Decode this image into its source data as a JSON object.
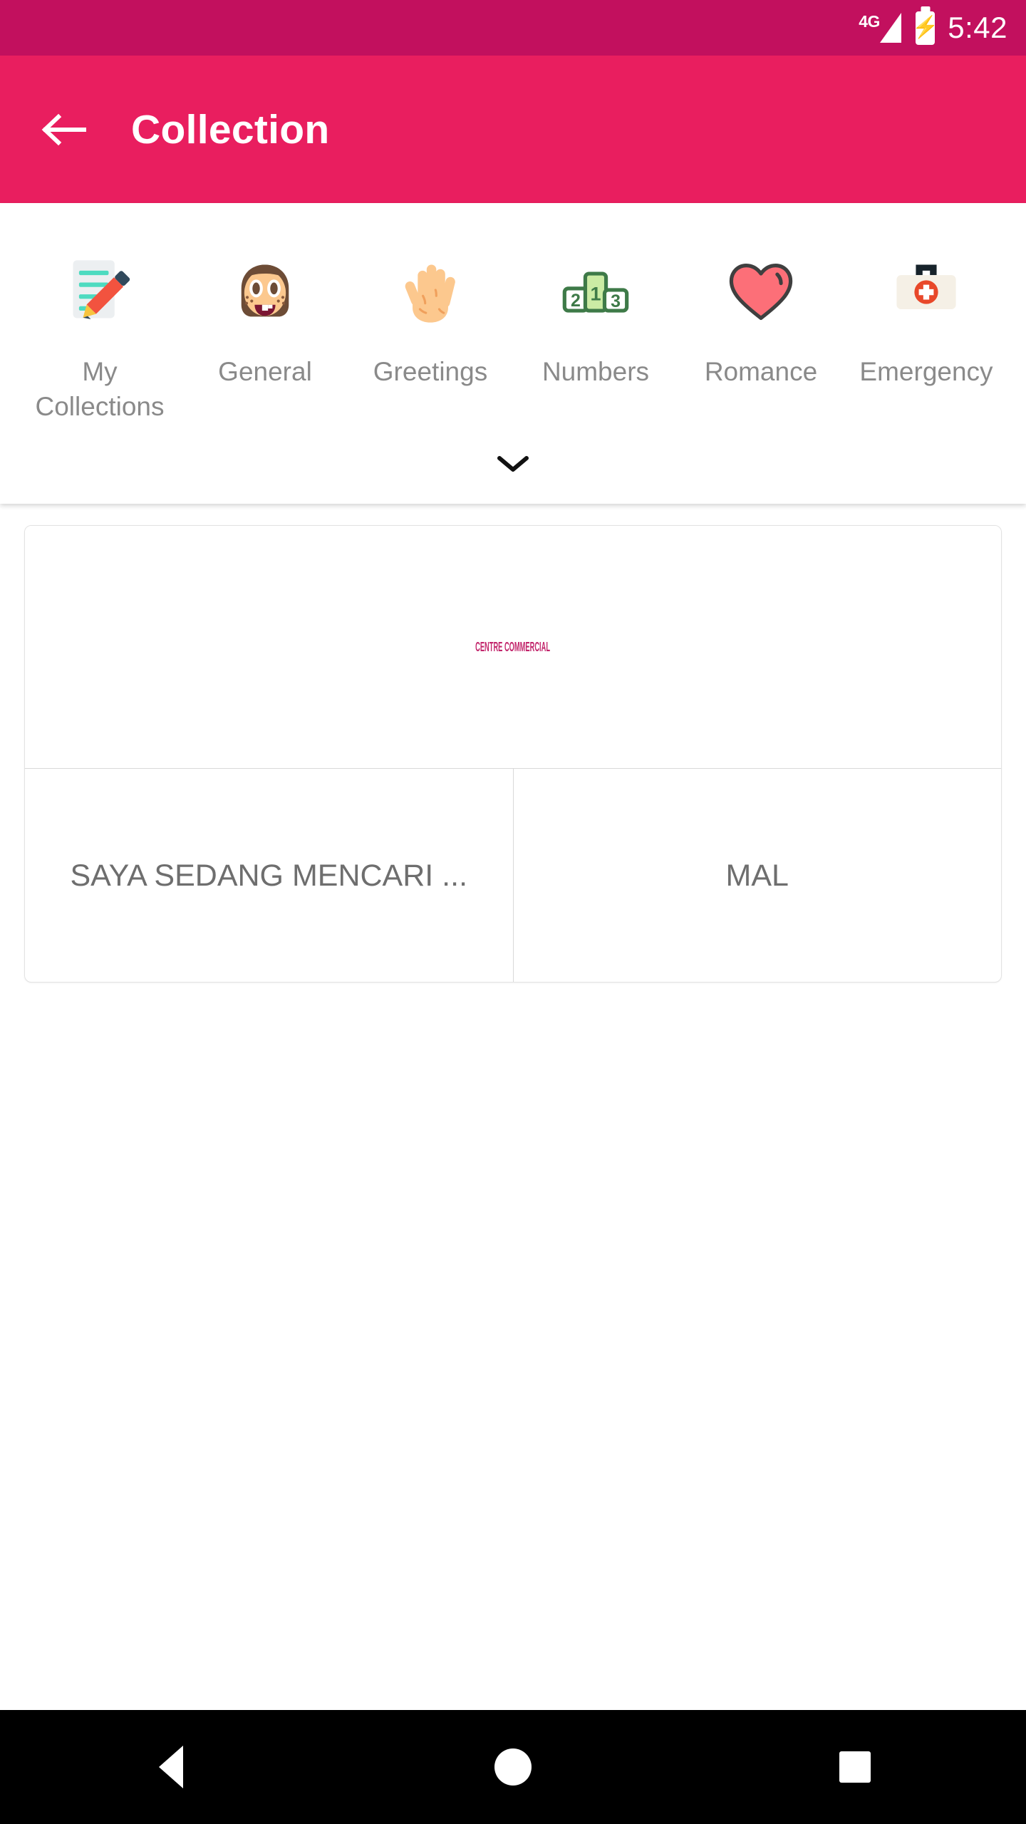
{
  "status_bar": {
    "network_label": "4G",
    "time": "5:42",
    "background_color": "#c2105e",
    "signal_icon": "signal-bars-icon",
    "battery_icon": "battery-charging-icon"
  },
  "app_bar": {
    "title": "Collection",
    "back_icon": "back-arrow-icon",
    "background_color": "#e91e5f",
    "text_color": "#ffffff"
  },
  "categories": {
    "expand_icon": "chevron-down-icon",
    "label_color": "#8a8a8a",
    "items": [
      {
        "label": "My Collections",
        "icon": "memo-pencil-icon"
      },
      {
        "label": "General",
        "icon": "girl-face-icon"
      },
      {
        "label": "Greetings",
        "icon": "raised-hand-icon"
      },
      {
        "label": "Numbers",
        "icon": "podium-123-icon"
      },
      {
        "label": "Romance",
        "icon": "heart-icon"
      },
      {
        "label": "Emergency",
        "icon": "first-aid-kit-icon"
      }
    ]
  },
  "content": {
    "card": {
      "image_caption": "CENTRE COMMERCIAL",
      "image_caption_color": "#c2256b",
      "cells": [
        {
          "text": "SAYA SEDANG MENCARI ..."
        },
        {
          "text": "MAL"
        }
      ]
    }
  },
  "nav_bar": {
    "back_icon": "nav-back-triangle-icon",
    "home_icon": "nav-home-circle-icon",
    "recents_icon": "nav-recents-square-icon",
    "background_color": "#000000"
  }
}
